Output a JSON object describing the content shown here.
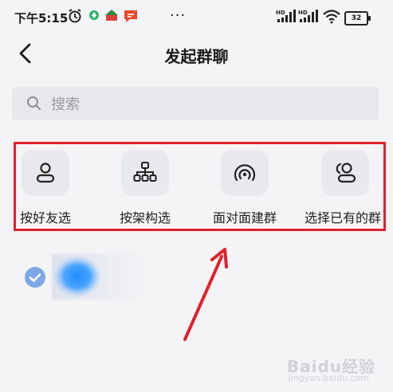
{
  "status_bar": {
    "time": "下午5:15",
    "dots": "···",
    "network1": "HD",
    "network2": "HD",
    "battery": "32"
  },
  "header": {
    "title": "发起群聊"
  },
  "search": {
    "placeholder": "搜索"
  },
  "actions": [
    {
      "label": "按好友选",
      "icon": "person-icon"
    },
    {
      "label": "按架构选",
      "icon": "org-chart-icon"
    },
    {
      "label": "面对面建群",
      "icon": "face-to-face-icon"
    },
    {
      "label": "选择已有的群",
      "icon": "group-icon"
    }
  ],
  "watermark": {
    "text": "Baidu经验",
    "sub": "jingyan.baidu.com"
  },
  "colors": {
    "accent": "#e0202a",
    "check": "#7da7e8",
    "arrow": "#e0202a"
  }
}
